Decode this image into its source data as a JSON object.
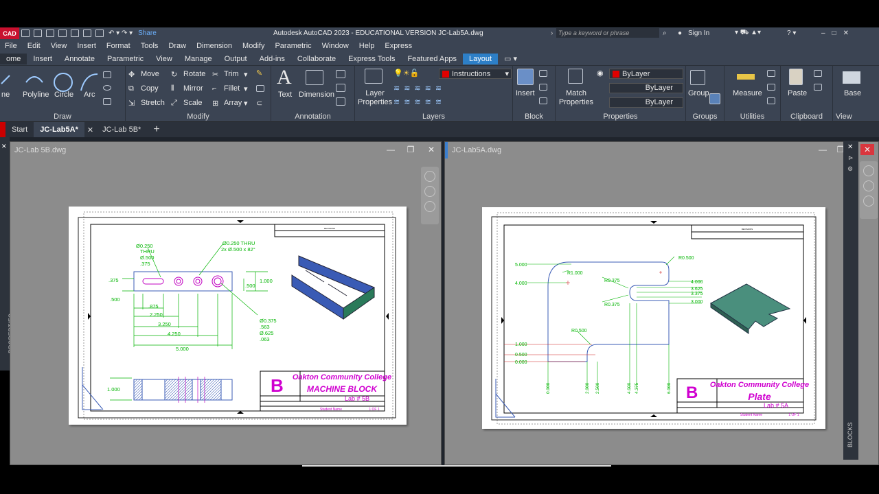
{
  "title_bar": {
    "app_logo": "CAD",
    "share": "Share",
    "title": "Autodesk AutoCAD 2023 - EDUCATIONAL VERSION    JC-Lab5A.dwg",
    "search_placeholder": "Type a keyword or phrase",
    "sign_in": "Sign In"
  },
  "menu": [
    "File",
    "Edit",
    "View",
    "Insert",
    "Format",
    "Tools",
    "Draw",
    "Dimension",
    "Modify",
    "Parametric",
    "Window",
    "Help",
    "Express"
  ],
  "ribbon_tabs": [
    {
      "label": "ome"
    },
    {
      "label": "Insert"
    },
    {
      "label": "Annotate"
    },
    {
      "label": "Parametric"
    },
    {
      "label": "View"
    },
    {
      "label": "Manage"
    },
    {
      "label": "Output"
    },
    {
      "label": "Add-ins"
    },
    {
      "label": "Collaborate"
    },
    {
      "label": "Express Tools"
    },
    {
      "label": "Featured Apps"
    },
    {
      "label": "Layout"
    }
  ],
  "ribbon": {
    "draw": {
      "title": "Draw",
      "polyline": "Polyline",
      "circle": "Circle",
      "arc": "Arc",
      "line": "ne"
    },
    "modify": {
      "title": "Modify",
      "move": "Move",
      "rotate": "Rotate",
      "trim": "Trim",
      "copy": "Copy",
      "mirror": "Mirror",
      "fillet": "Fillet",
      "stretch": "Stretch",
      "scale": "Scale",
      "array": "Array"
    },
    "annotation": {
      "title": "Annotation",
      "text": "Text",
      "dimension": "Dimension"
    },
    "layers": {
      "title": "Layers",
      "layer_props": "Layer Properties",
      "current_layer": "Instructions"
    },
    "block": {
      "title": "Block",
      "insert": "Insert"
    },
    "properties": {
      "title": "Properties",
      "match": "Match Properties",
      "color": "ByLayer",
      "linetype": "ByLayer",
      "lineweight": "ByLayer"
    },
    "groups": {
      "title": "Groups",
      "group": "Group"
    },
    "utilities": {
      "title": "Utilities",
      "measure": "Measure"
    },
    "clipboard": {
      "title": "Clipboard",
      "paste": "Paste"
    },
    "view": {
      "title": "View",
      "base": "Base"
    }
  },
  "file_tabs": [
    "Start",
    "JC-Lab5A*",
    "JC-Lab 5B*"
  ],
  "left_sidebar": "PROPERTIES",
  "right_sidebar": "BLOCKS",
  "viewport_left": {
    "title": "JC-Lab 5B.dwg",
    "callouts": [
      "Ø0.250",
      "THRU",
      "Ø.500",
      ".375",
      "Ø0.250 THRU",
      "2x Ø.500 x 82°",
      "Ø0.375",
      ".563",
      "Ø.625",
      ".063"
    ],
    "dims": [
      ".375",
      ".500",
      ".875",
      "2.250",
      "3.250",
      "4.250",
      "5.000",
      ".500",
      "1.000",
      "1.000"
    ],
    "tb": {
      "letter": "B",
      "school": "Oakton Community College",
      "part": "MACHINE BLOCK",
      "lab": "Lab # 5B",
      "student": "Student Name",
      "sheet": "1 OF 1",
      "rev": "REVISIONS"
    }
  },
  "viewport_right": {
    "title": "JC-Lab5A.dwg",
    "dims": [
      "5.000",
      "4.000",
      "R1.000",
      "R0.500",
      "R0.375",
      "R0.375",
      "4.000",
      "3.625",
      "3.375",
      "3.000",
      "R0.500",
      "1.000",
      "0.500",
      "0.000",
      "0.000",
      "2.000",
      "2.500",
      "4.000",
      "4.375",
      "6.000"
    ],
    "tb": {
      "letter": "B",
      "school": "Oakton Community College",
      "part": "Plate",
      "lab": "Lab # 5A",
      "student": "Student Name",
      "sheet": "1 OF 1",
      "rev": "REVISIONS"
    }
  },
  "colors": {
    "accent": "#2d7fc7",
    "dim_green": "#00b400",
    "magenta": "#d000d0",
    "part_blue": "#3a5bb5",
    "plate_teal": "#4a8f7d"
  }
}
